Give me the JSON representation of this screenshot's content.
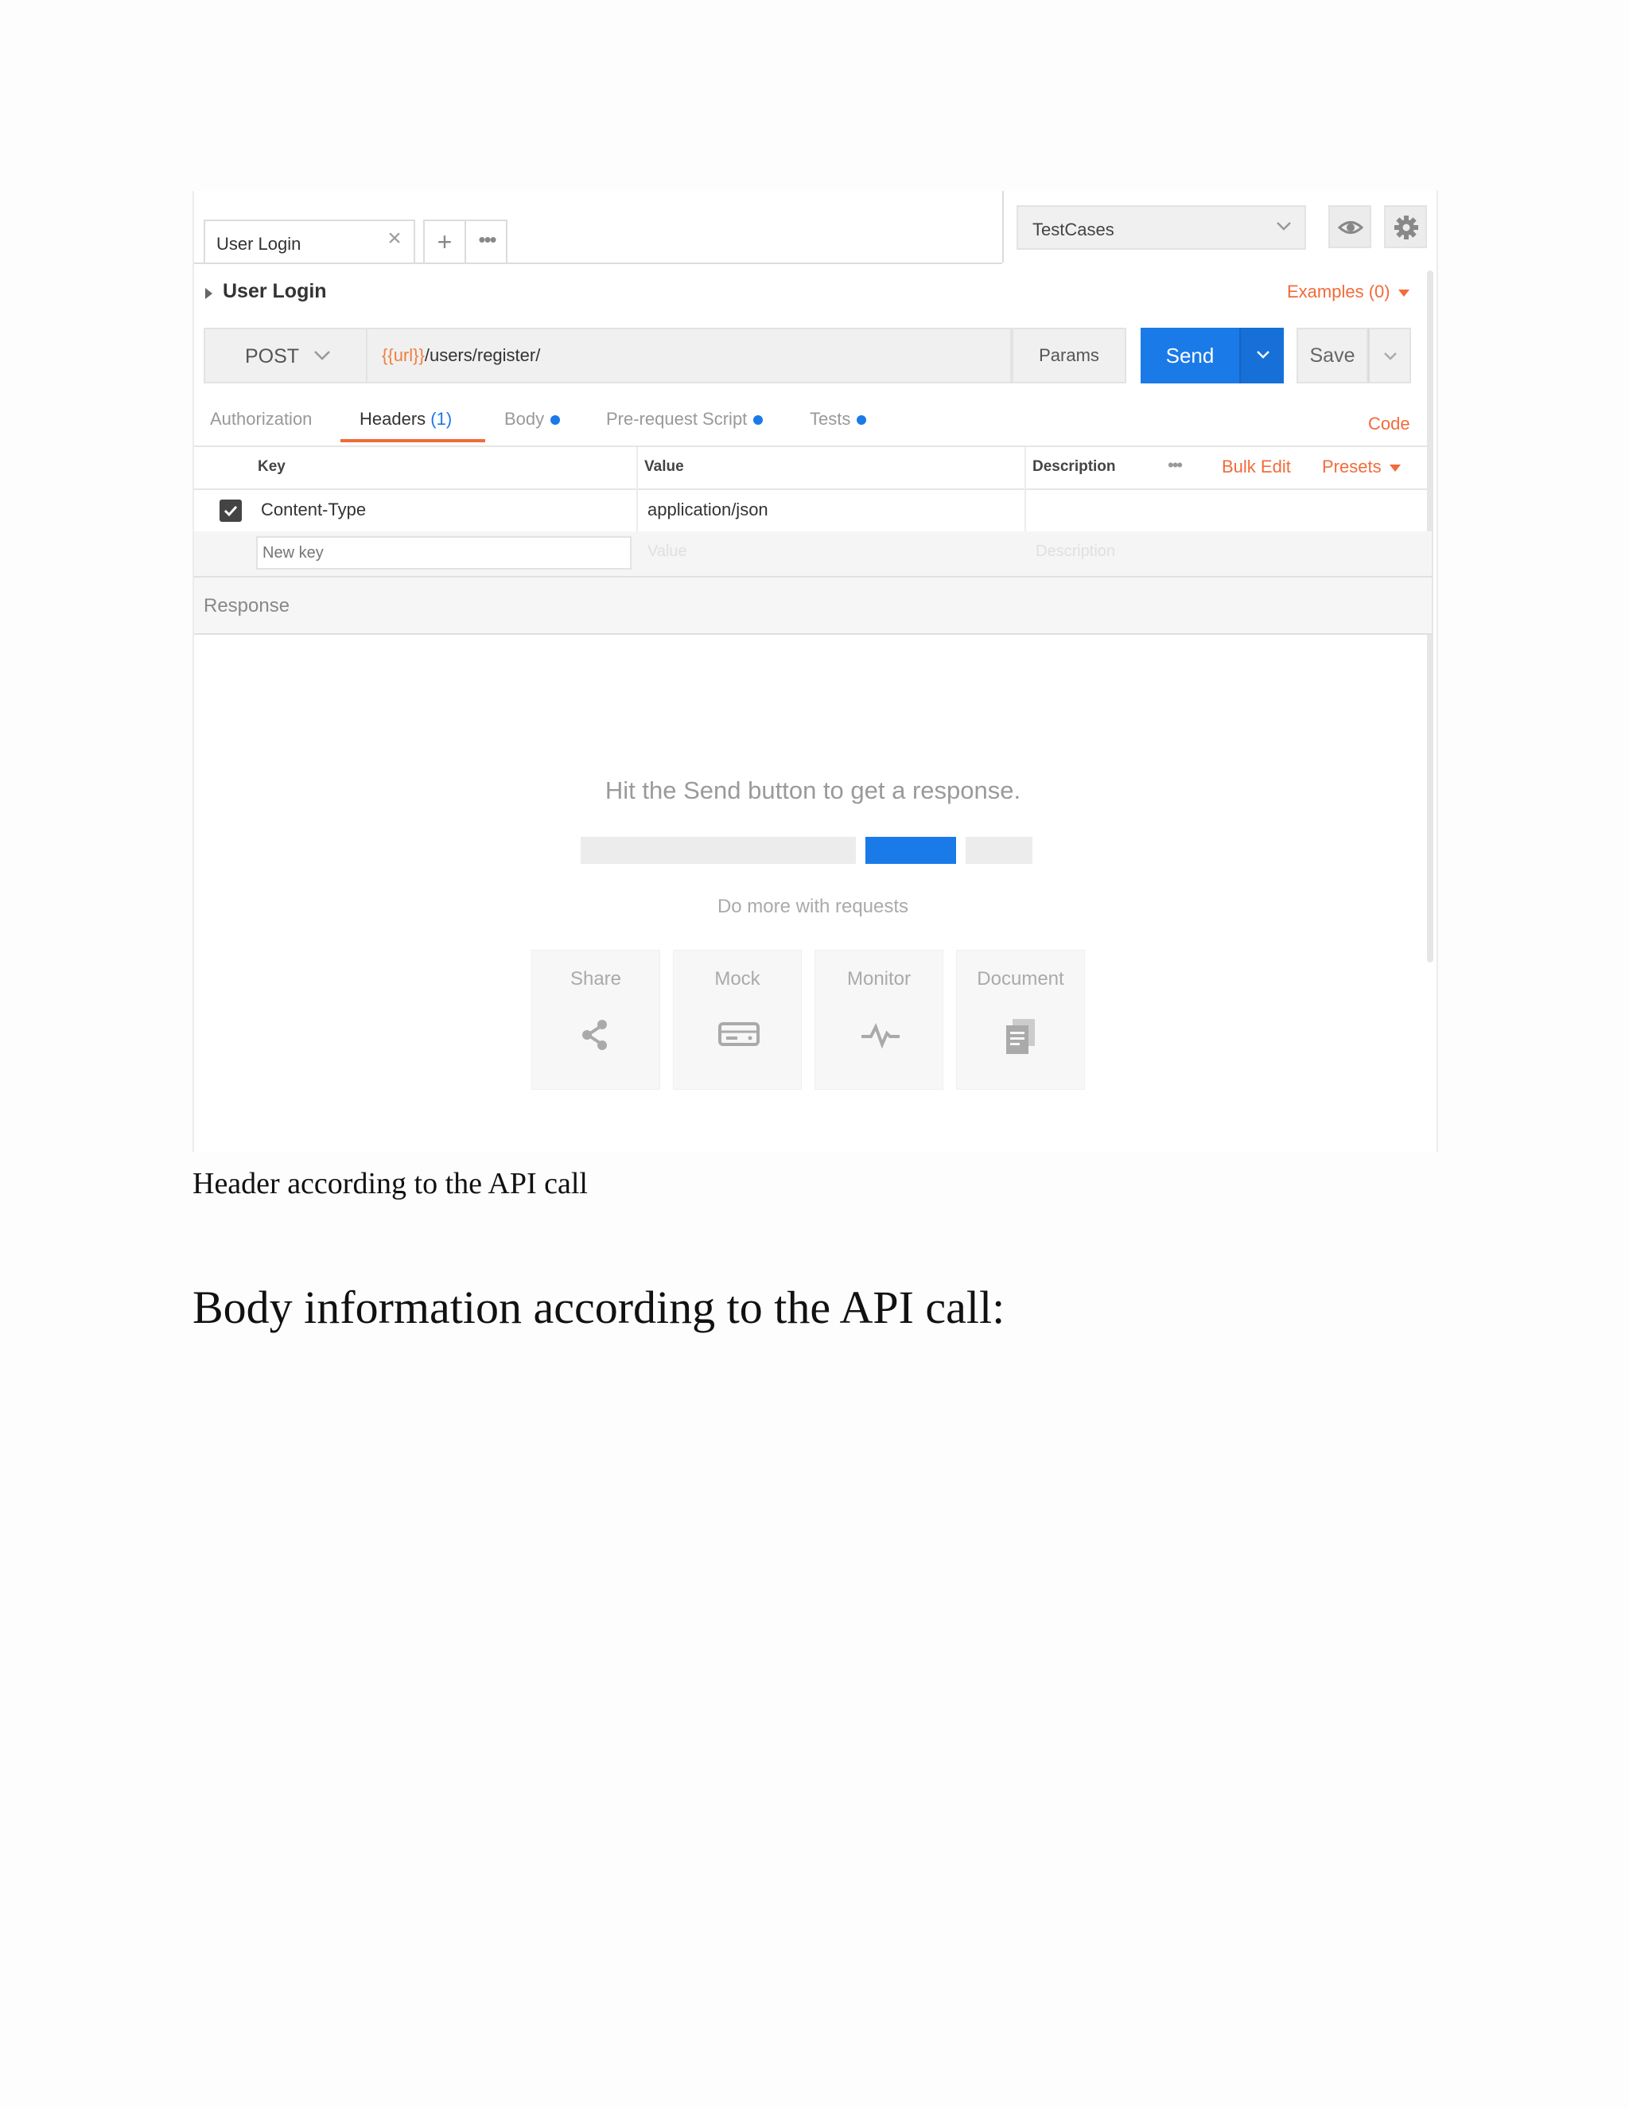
{
  "tabs": {
    "active_tab": "User Login",
    "close_glyph": "×",
    "new_tab_glyph": "+",
    "more_glyph": "•••"
  },
  "environment": {
    "selected": "TestCases"
  },
  "request": {
    "name": "User Login",
    "examples_label": "Examples (0)",
    "method": "POST",
    "url_variable": "{{url}}",
    "url_path": "/users/register/",
    "params_label": "Params",
    "send_label": "Send",
    "save_label": "Save"
  },
  "subtabs": {
    "authorization": "Authorization",
    "headers": "Headers",
    "headers_count": "(1)",
    "body": "Body",
    "prerequest": "Pre-request Script",
    "tests": "Tests",
    "active": "Headers",
    "code_label": "Code"
  },
  "headers_table": {
    "columns": {
      "key": "Key",
      "value": "Value",
      "description": "Description"
    },
    "more_glyph": "•••",
    "bulk_edit_label": "Bulk Edit",
    "presets_label": "Presets",
    "rows": [
      {
        "checked": true,
        "key": "Content-Type",
        "value": "application/json",
        "description": ""
      }
    ],
    "new_row": {
      "key_placeholder": "New key",
      "value_placeholder": "Value",
      "description_placeholder": "Description"
    }
  },
  "response": {
    "label": "Response",
    "hint": "Hit the Send button to get a response.",
    "do_more": "Do more with requests",
    "cards": [
      {
        "label": "Share",
        "icon": "share-icon"
      },
      {
        "label": "Mock",
        "icon": "mock-server-icon"
      },
      {
        "label": "Monitor",
        "icon": "monitor-pulse-icon"
      },
      {
        "label": "Document",
        "icon": "document-icon"
      }
    ]
  },
  "document": {
    "caption": "Header according to the API call",
    "heading": "Body information according to the API call:"
  },
  "colors": {
    "accent_blue": "#1a7ae8",
    "accent_orange": "#f26b3a"
  }
}
